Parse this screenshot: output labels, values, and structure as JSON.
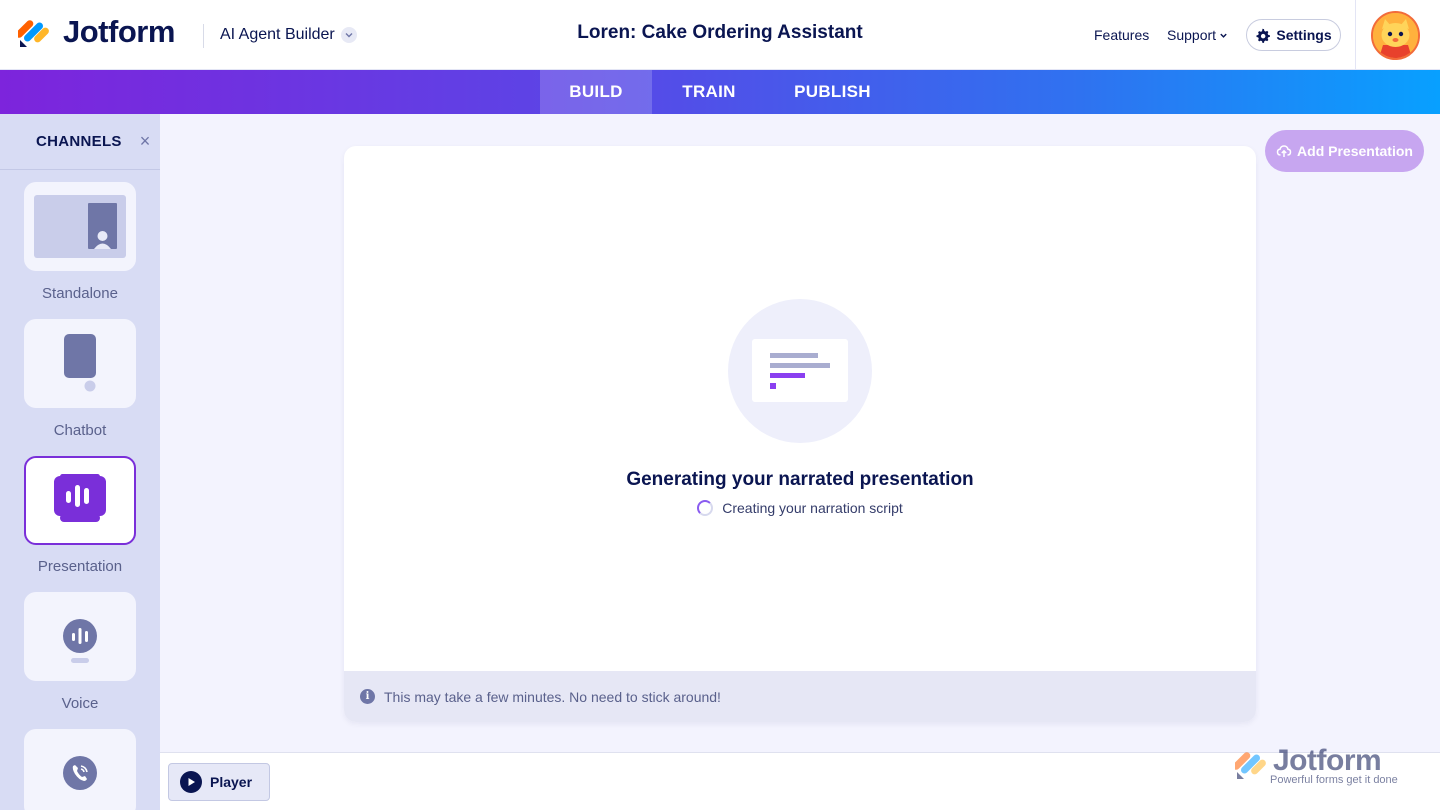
{
  "header": {
    "logo_text": "Jotform",
    "product_name": "AI Agent Builder",
    "agent_title": "Loren: Cake Ordering Assistant",
    "nav": {
      "features": "Features",
      "support": "Support",
      "settings": "Settings"
    }
  },
  "tabs": [
    {
      "label": "BUILD",
      "active": true
    },
    {
      "label": "TRAIN",
      "active": false
    },
    {
      "label": "PUBLISH",
      "active": false
    }
  ],
  "sidebar": {
    "title": "CHANNELS",
    "close_symbol": "×",
    "channels": [
      {
        "label": "Standalone",
        "icon": "standalone-icon",
        "active": false
      },
      {
        "label": "Chatbot",
        "icon": "chatbot-icon",
        "active": false
      },
      {
        "label": "Presentation",
        "icon": "presentation-icon",
        "active": true
      },
      {
        "label": "Voice",
        "icon": "voice-icon",
        "active": false
      },
      {
        "label": "",
        "icon": "phone-icon",
        "active": false
      }
    ]
  },
  "main": {
    "add_button_label": "Add Presentation",
    "status_title": "Generating your narrated presentation",
    "status_message": "Creating your narration script",
    "footer_note": "This may take a few minutes. No need to stick around!",
    "info_symbol": "i"
  },
  "bottom_bar": {
    "player_label": "Player"
  },
  "watermark": {
    "brand": "Jotform",
    "tagline": "Powerful forms get it done"
  },
  "colors": {
    "navy": "#0a1551",
    "accent_purple": "#7a2fd9",
    "add_button": "#c7a6f0",
    "sidebar_bg": "#d8dcf4",
    "canvas_bg": "#f3f3fe"
  }
}
